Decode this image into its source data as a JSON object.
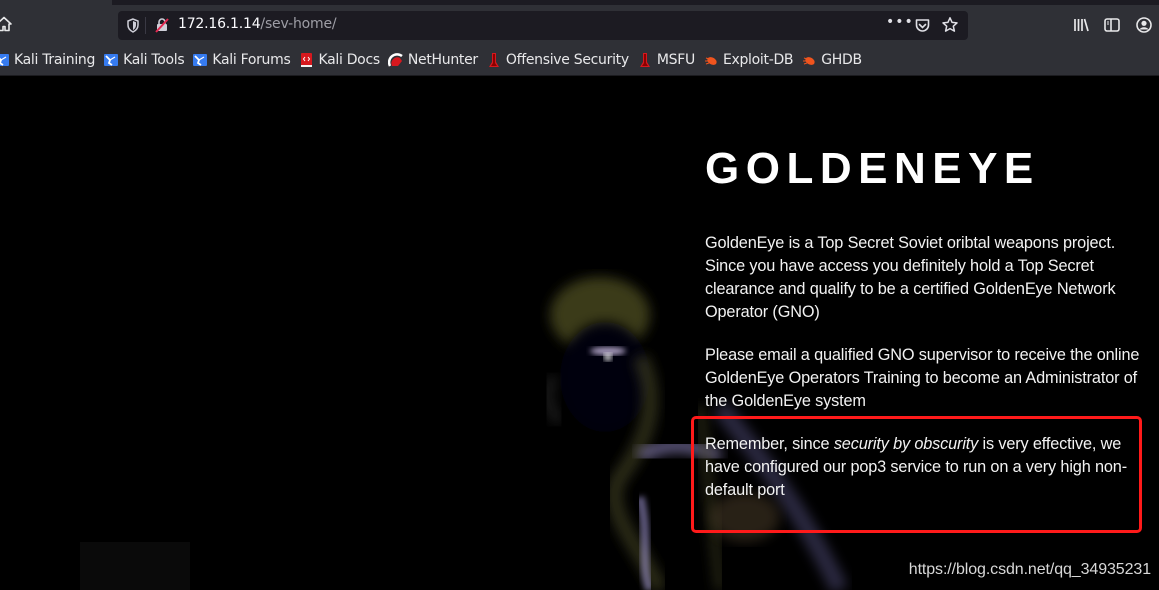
{
  "browser": {
    "url": {
      "host": "172.16.1.14",
      "path": "/sev-home/"
    },
    "url_actions": {
      "more": "•••"
    },
    "icons": {
      "home": "home-icon",
      "tracking_protection": "shield-icon",
      "connection": "insecure-lock-icon",
      "more": "ellipsis-icon",
      "pocket": "pocket-icon",
      "bookmark": "star-icon",
      "library": "library-icon",
      "sidebar": "sidebar-icon",
      "account": "account-icon"
    },
    "bookmarks": [
      {
        "label": "Kali Training",
        "icon": "kali-icon"
      },
      {
        "label": "Kali Tools",
        "icon": "kali-icon"
      },
      {
        "label": "Kali Forums",
        "icon": "kali-icon"
      },
      {
        "label": "Kali Docs",
        "icon": "kali-docs-icon"
      },
      {
        "label": "NetHunter",
        "icon": "nethunter-icon"
      },
      {
        "label": "Offensive Security",
        "icon": "offsec-icon"
      },
      {
        "label": "MSFU",
        "icon": "offsec-icon"
      },
      {
        "label": "Exploit-DB",
        "icon": "exploitdb-icon"
      },
      {
        "label": "GHDB",
        "icon": "exploitdb-icon"
      }
    ]
  },
  "page": {
    "title": "GOLDENEYE",
    "paragraphs": [
      "GoldenEye is a Top Secret Soviet oribtal weapons project. Since you have access you definitely hold a Top Secret clearance and qualify to be a certified GoldenEye Network Operator (GNO)",
      "Please email a qualified GNO supervisor to receive the online GoldenEye Operators Training to become an Administrator of the GoldenEye system"
    ],
    "highlight_paragraph": {
      "before": "Remember, since ",
      "emphasis": "security by obscurity",
      "after": " is very effective, we have configured our pop3 service to run on a very high non-default port"
    },
    "highlight_color": "#ff1a1a"
  },
  "watermark": "https://blog.csdn.net/qq_34935231"
}
